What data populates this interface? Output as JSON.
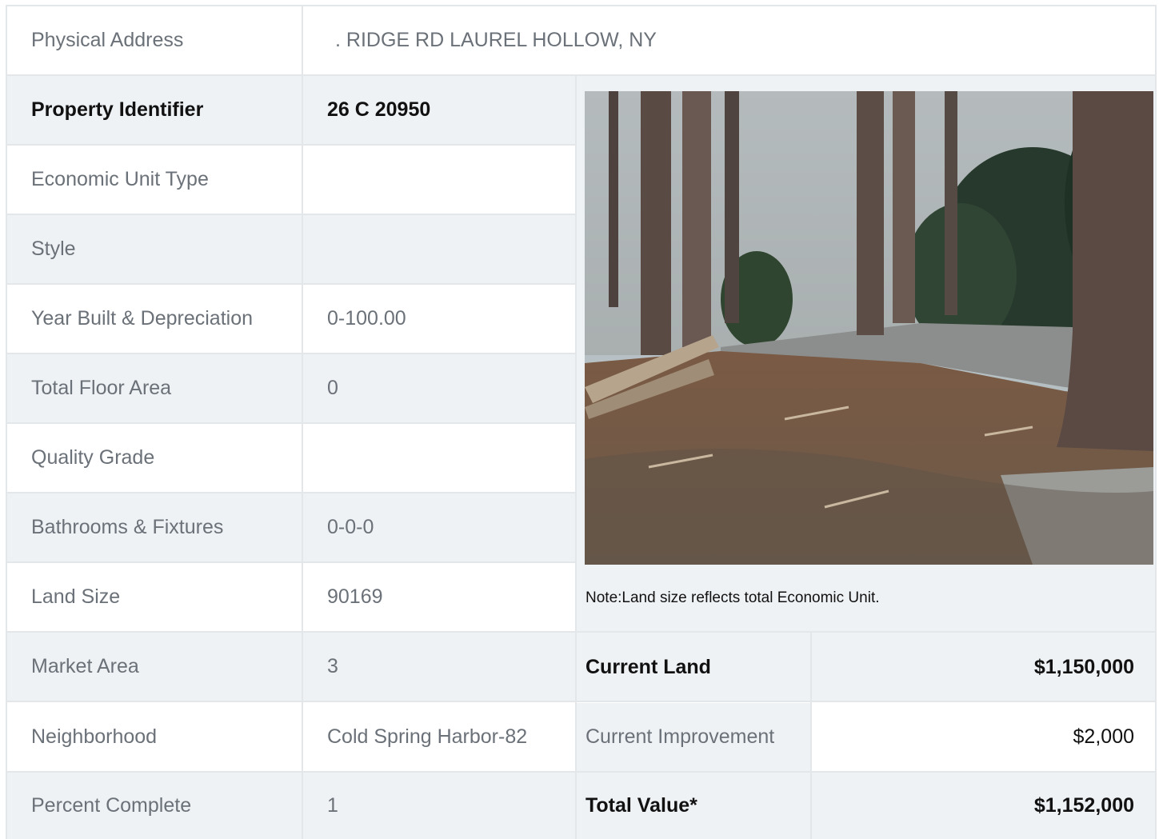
{
  "address": {
    "label": "Physical Address",
    "value": ".  RIDGE RD  LAUREL HOLLOW, NY"
  },
  "rows": [
    {
      "label": "Property Identifier",
      "value": "26  C  20950"
    },
    {
      "label": "Economic Unit Type",
      "value": ""
    },
    {
      "label": "Style",
      "value": ""
    },
    {
      "label": "Year Built & Depreciation",
      "value": "0-100.00"
    },
    {
      "label": "Total Floor Area",
      "value": "0"
    },
    {
      "label": "Quality Grade",
      "value": ""
    },
    {
      "label": "Bathrooms & Fixtures",
      "value": "0-0-0"
    },
    {
      "label": "Land Size",
      "value": "90169"
    },
    {
      "label": "Market Area",
      "value": "3"
    },
    {
      "label": "Neighborhood",
      "value": "Cold Spring Harbor-82"
    },
    {
      "label": "Percent Complete",
      "value": "1"
    }
  ],
  "note": "Note:Land size reflects total Economic Unit.",
  "values": [
    {
      "label": "Current Land",
      "value": "$1,150,000"
    },
    {
      "label": "Current Improvement",
      "value": "$2,000"
    },
    {
      "label": "Total Value*",
      "value": "$1,152,000"
    }
  ],
  "colors": {
    "row_gray": "#eff2f5",
    "border": "#e4e7ea",
    "label_text": "#6b7178",
    "bold_text": "#111111"
  }
}
